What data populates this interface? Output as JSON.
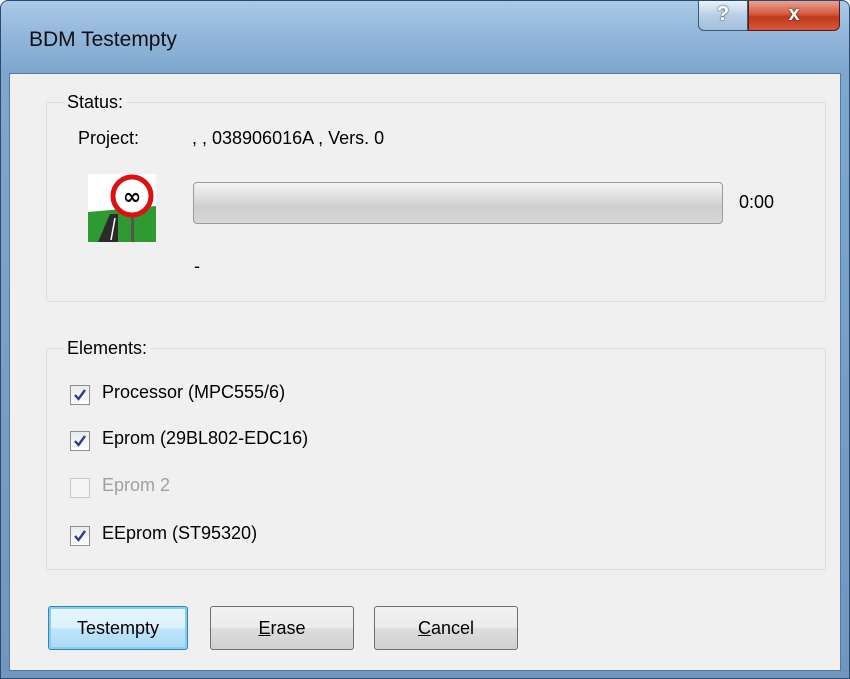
{
  "window": {
    "title": "BDM Testempty"
  },
  "titlebar_buttons": {
    "help": "?",
    "close": "x"
  },
  "status": {
    "legend": "Status:",
    "project_label": "Project:",
    "project_value": ", , 038906016A , Vers. 0",
    "progress_percent": 0,
    "time": "0:00",
    "message": "-",
    "icon": "infinity-road-sign-icon"
  },
  "elements": {
    "legend": "Elements:",
    "items": [
      {
        "label": "Processor (MPC555/6)",
        "checked": true,
        "enabled": true
      },
      {
        "label": "Eprom (29BL802-EDC16)",
        "checked": true,
        "enabled": true
      },
      {
        "label": "Eprom 2",
        "checked": false,
        "enabled": false
      },
      {
        "label": "EEprom (ST95320)",
        "checked": true,
        "enabled": true
      }
    ]
  },
  "buttons": {
    "testempty": "Testempty",
    "erase_first": "E",
    "erase_rest": "rase",
    "cancel_first": "C",
    "cancel_rest": "ancel"
  }
}
